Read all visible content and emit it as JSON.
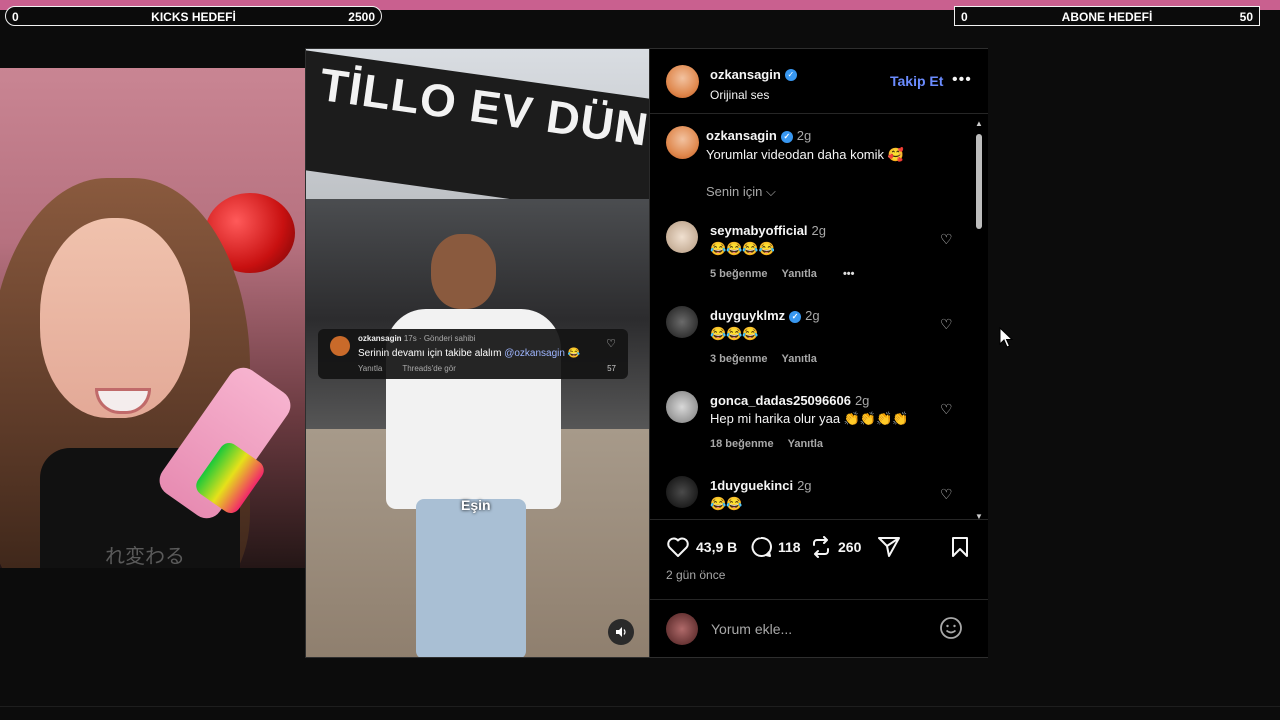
{
  "goals": {
    "kicks": {
      "min": "0",
      "label": "KICKS HEDEFİ",
      "max": "2500"
    },
    "abone": {
      "min": "0",
      "label": "ABONE HEDEFİ",
      "max": "50"
    }
  },
  "webcam": {
    "shirt_text": "れ変わる"
  },
  "video": {
    "sign_text": "TİLLO EV DÜNYASI",
    "overlay": {
      "user": "ozkansagin",
      "meta": "17s · Gönderi sahibi",
      "text": "Serinin devamı için takibe alalım",
      "mention": "@ozkansagin",
      "emoji": "😂",
      "reply": "Yanıtla",
      "threads": "Threads'de gör",
      "likes": "57"
    },
    "subtitle": "Eşin"
  },
  "post": {
    "author": "ozkansagin",
    "audio": "Orijinal ses",
    "follow_label": "Takip Et",
    "more": "•••",
    "caption": {
      "user": "ozkansagin",
      "time": "2g",
      "text": "Yorumlar videodan daha komik 🥰"
    },
    "sort_label": "Senin için ⌵",
    "comments": [
      {
        "user": "seymabyofficial",
        "time": "2g",
        "text": "😂😂😂😂",
        "likes": "5 beğenme",
        "reply": "Yanıtla",
        "more": "•••"
      },
      {
        "user": "duyguyklmz",
        "time": "2g",
        "text": "😂😂😂",
        "likes": "3 beğenme",
        "reply": "Yanıtla",
        "verified": true
      },
      {
        "user": "gonca_dadas25096606",
        "time": "2g",
        "text": "Hep mi harika olur yaa 👏👏👏👏",
        "likes": "18 beğenme",
        "reply": "Yanıtla"
      },
      {
        "user": "1duyguekinci",
        "time": "2g",
        "text": "😂😂"
      }
    ],
    "stats": {
      "likes": "43,9 B",
      "comments": "118",
      "reposts": "260"
    },
    "date": "2 gün önce",
    "add_comment_placeholder": "Yorum ekle..."
  }
}
